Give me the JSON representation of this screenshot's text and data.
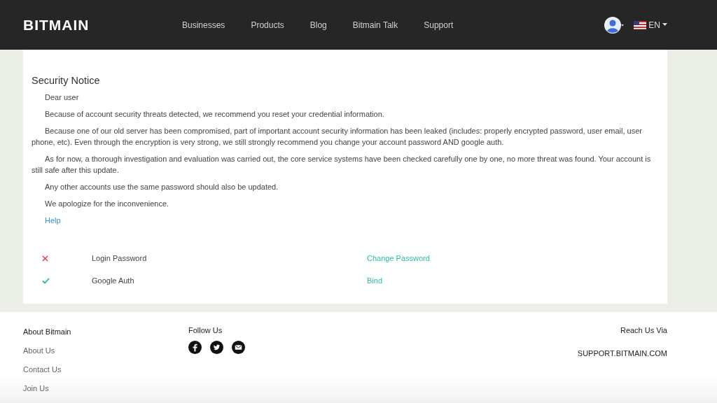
{
  "header": {
    "logo": "BITMAIN",
    "nav": [
      {
        "label": "Businesses"
      },
      {
        "label": "Products"
      },
      {
        "label": "Blog"
      },
      {
        "label": "Bitmain Talk"
      },
      {
        "label": "Support"
      }
    ],
    "language": "EN"
  },
  "notice": {
    "title": "Security Notice",
    "paragraphs": [
      "Dear user",
      "Because of account security threats detected, we recommend you reset your credential information.",
      "Because one of our old server has been compromised, part of important account security information has been leaked (includes: properly encrypted password, user email, user phone, etc). Even through the encryption is very strong, we still strongly recommend you change your account password AND google auth.",
      "As for now, a thorough investigation and evaluation was carried out, the core service systems have been checked carefully one by one, no more threat was found. Your account is still safe after this update.",
      "Any other accounts use the same password should also be updated.",
      "We apologize for the inconvenience."
    ],
    "help_link": "Help"
  },
  "security_items": [
    {
      "name": "Login Password",
      "ok": false,
      "action": "Change Password"
    },
    {
      "name": "Google Auth",
      "ok": true,
      "action": "Bind"
    }
  ],
  "footer": {
    "about_title": "About Bitmain",
    "about_links": [
      "About Us",
      "Contact Us",
      "Join Us"
    ],
    "follow_title": "Follow Us",
    "reach_title": "Reach Us Via",
    "reach_value": "SUPPORT.BITMAIN.COM"
  }
}
